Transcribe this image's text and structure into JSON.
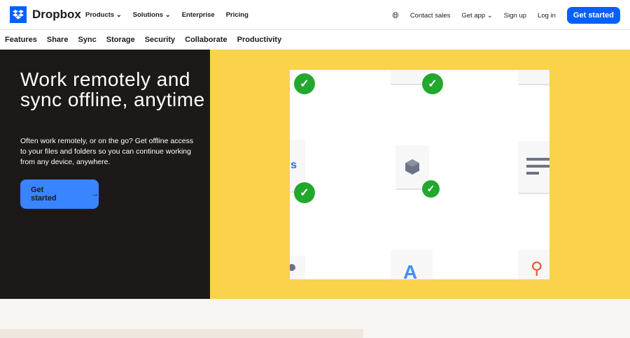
{
  "header": {
    "brand": "Dropbox",
    "nav": [
      "Products",
      "Solutions",
      "Enterprise",
      "Pricing"
    ],
    "right": {
      "contact": "Contact sales",
      "get_app": "Get app",
      "signup": "Sign up",
      "login": "Log in",
      "cta": "Get started"
    }
  },
  "subnav": [
    "Features",
    "Share",
    "Sync",
    "Storage",
    "Security",
    "Collaborate",
    "Productivity"
  ],
  "hero": {
    "title": "Work remotely and sync offline, anytime",
    "description": "Often work remotely, or on the go? Get offline access to your files and folders so you can continue working from any device, anywhere.",
    "cta": "Get started"
  },
  "colors": {
    "brand": "#0061fe",
    "hero_dark": "#1e1919",
    "hero_yellow": "#fad24b",
    "check": "#22a82d"
  }
}
